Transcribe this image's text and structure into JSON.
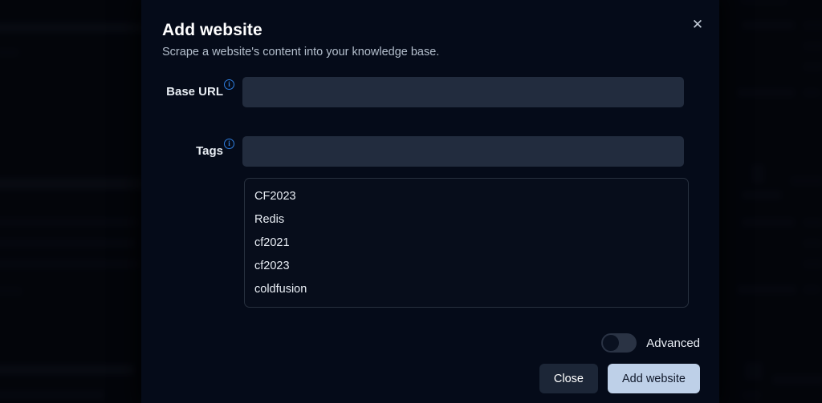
{
  "modal": {
    "title": "Add website",
    "subtitle": "Scrape a website's content into your knowledge base.",
    "close_icon": "close-icon",
    "fields": [
      {
        "label": "Base URL",
        "value": "",
        "placeholder": "",
        "info_icon": "info-icon",
        "info_glyph": "i"
      },
      {
        "label": "Tags",
        "value": "",
        "placeholder": "",
        "info_icon": "info-icon",
        "info_glyph": "i"
      }
    ],
    "tag_suggestions": [
      "CF2023",
      "Redis",
      "cf2021",
      "cf2023",
      "coldfusion",
      "."
    ],
    "advanced": {
      "label": "Advanced",
      "state": "off"
    },
    "actions": {
      "close_label": "Close",
      "submit_label": "Add website"
    },
    "colors": {
      "modal_background": "#050b19",
      "input_background": "#222c3e",
      "accent_info": "#2f7fe0",
      "primary_button": "#bed0e8",
      "secondary_button": "#1c2637",
      "toggle_track": "#2a3344"
    }
  }
}
